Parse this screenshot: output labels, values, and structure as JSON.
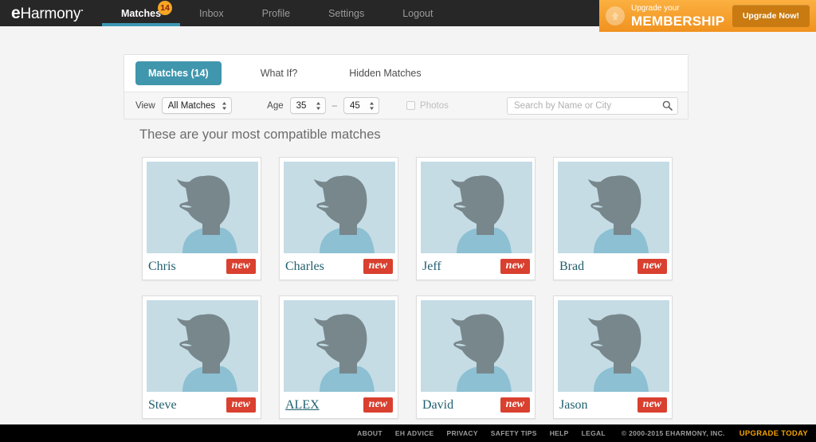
{
  "brand": {
    "name": "eHarmony"
  },
  "topnav": {
    "items": [
      {
        "label": "Matches",
        "active": true,
        "badge": "14"
      },
      {
        "label": "Inbox",
        "active": false,
        "badge": ""
      },
      {
        "label": "Profile",
        "active": false,
        "badge": ""
      },
      {
        "label": "Settings",
        "active": false,
        "badge": ""
      },
      {
        "label": "Logout",
        "active": false,
        "badge": ""
      }
    ]
  },
  "upgrade_banner": {
    "small_text": "Upgrade your",
    "big_text": "MEMBERSHIP",
    "button_label": "Upgrade Now!",
    "icon": "up-arrow-icon",
    "bg_color": "#f0921f",
    "button_color": "#c97b12"
  },
  "panel": {
    "tabs": [
      {
        "label": "Matches (14)",
        "active": true
      },
      {
        "label": "What If?",
        "active": false
      },
      {
        "label": "Hidden Matches",
        "active": false
      }
    ],
    "active_tab_color": "#3f96ad",
    "filters": {
      "view_label": "View",
      "view_value": "All Matches",
      "age_label": "Age",
      "age_min": "35",
      "age_range_separator": "–",
      "age_max": "45",
      "photos_label": "Photos",
      "photos_checked": false
    },
    "search": {
      "placeholder": "Search by Name or City",
      "value": "",
      "icon": "search-icon"
    }
  },
  "main": {
    "heading": "These are your most compatible matches",
    "cards": [
      {
        "name": "Chris",
        "badge": "new",
        "hovered": false
      },
      {
        "name": "Charles",
        "badge": "new",
        "hovered": false
      },
      {
        "name": "Jeff",
        "badge": "new",
        "hovered": false
      },
      {
        "name": "Brad",
        "badge": "new",
        "hovered": false
      },
      {
        "name": "Steve",
        "badge": "new",
        "hovered": false
      },
      {
        "name": "ALEX",
        "badge": "new",
        "hovered": true
      },
      {
        "name": "David",
        "badge": "new",
        "hovered": false
      },
      {
        "name": "Jason",
        "badge": "new",
        "hovered": false
      }
    ],
    "avatar": {
      "icon": "male-silhouette-placeholder-icon",
      "bg_color": "#c5dce5",
      "head_color": "#78878c",
      "shirt_color": "#8cc0d2"
    },
    "badge_color": "#d9402f",
    "name_color": "#1f5f6e"
  },
  "footer": {
    "links": [
      "ABOUT",
      "EH ADVICE",
      "PRIVACY",
      "SAFETY TIPS",
      "HELP",
      "LEGAL"
    ],
    "copyright": "© 2000-2015 EHARMONY, INC.",
    "upgrade_label": "UPGRADE TODAY",
    "upgrade_color": "#f5a300"
  }
}
